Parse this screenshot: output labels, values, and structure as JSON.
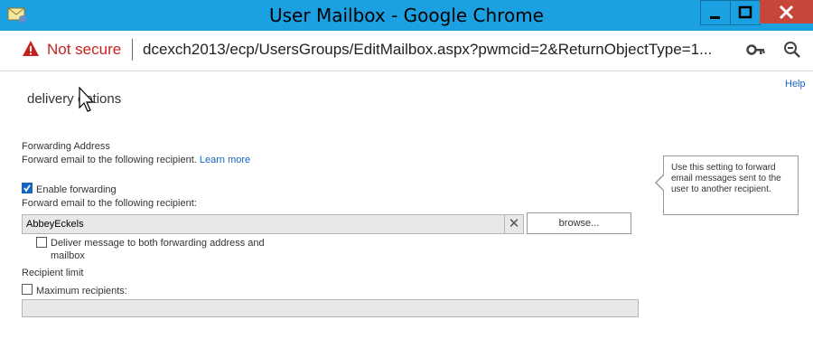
{
  "window": {
    "title": "User Mailbox - Google Chrome",
    "titlebar_color": "#1ba1e2"
  },
  "address_bar": {
    "security_text": "Not secure",
    "url": "dcexch2013/ecp/UsersGroups/EditMailbox.aspx?pwmcid=2&ReturnObjectType=1..."
  },
  "page": {
    "help_link": "Help",
    "heading": "delivery options",
    "forwarding_address": {
      "title": "Forwarding Address",
      "description": "Forward email to the following recipient.",
      "learn_more": "Learn more"
    },
    "enable_forwarding": {
      "label": "Enable forwarding",
      "checked": true
    },
    "forward_to_label": "Forward email to the following recipient:",
    "recipient_value": "AbbeyEckels",
    "clear_symbol": "✕",
    "browse_label": "browse...",
    "deliver_both": {
      "line1": "Deliver message to both forwarding address and",
      "line2": "mailbox",
      "checked": false
    },
    "recipient_limit": {
      "title": "Recipient limit",
      "max_label": "Maximum recipients:",
      "checked": false,
      "value": ""
    },
    "tooltip": {
      "line1": "Use this setting to forward",
      "line2": "email messages sent to the",
      "line3": "user to another recipient."
    }
  },
  "icons": {
    "app": "mail-envelope-icon",
    "warning": "warning-triangle-icon",
    "key": "key-icon",
    "zoom": "zoom-out-icon"
  }
}
